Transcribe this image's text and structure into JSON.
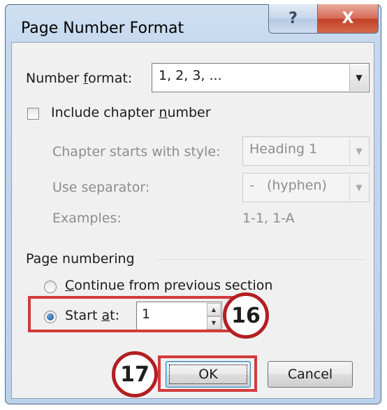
{
  "window": {
    "title": "Page Number Format",
    "help_glyph": "?",
    "close_glyph": "X"
  },
  "number_format": {
    "label_pre": "Number ",
    "label_accel": "f",
    "label_post": "ormat:",
    "value": "1, 2, 3, ...",
    "arrow": "▼"
  },
  "chapter": {
    "checkbox_pre": "Include chapter ",
    "checkbox_accel": "n",
    "checkbox_post": "umber",
    "checked": false,
    "starts_with_label": "Chapter starts with style:",
    "starts_with_value": "Heading 1",
    "separator_label": "Use separator:",
    "separator_value": "-   (hyphen)",
    "examples_label": "Examples:",
    "examples_value": "1-1, 1-A",
    "arrow": "▼"
  },
  "page_numbering": {
    "group_label": "Page numbering",
    "continue_accel": "C",
    "continue_post": "ontinue from previous section",
    "start_pre": "Start ",
    "start_accel": "a",
    "start_post": "t:",
    "start_value": "1",
    "selected": "start_at",
    "spin_up": "▲",
    "spin_down": "▼"
  },
  "buttons": {
    "ok": "OK",
    "cancel": "Cancel"
  },
  "annotations": {
    "step_16": "16",
    "step_17": "17",
    "highlight_color": "#d23b3b",
    "badge_color": "#b31e22"
  }
}
